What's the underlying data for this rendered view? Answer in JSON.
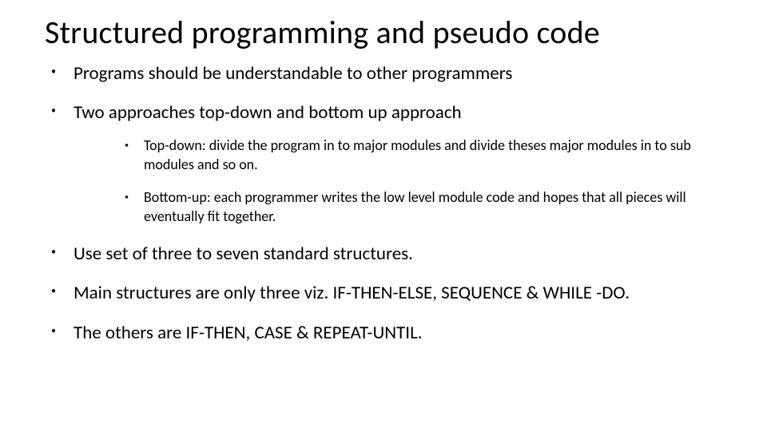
{
  "title": "Structured programming and pseudo code",
  "bullets": [
    {
      "text": "Programs should be understandable to other programmers"
    },
    {
      "text": "Two approaches top-down and bottom up approach",
      "children": [
        "Top-down: divide the program in to major modules and divide theses major modules in to sub modules and so on.",
        "Bottom-up: each programmer writes the low level module code and hopes that all pieces will eventually fit together."
      ]
    },
    {
      "text": "Use set of three to seven standard structures."
    },
    {
      "text": "Main structures are only three viz. IF-THEN-ELSE, SEQUENCE & WHILE -DO."
    },
    {
      "text": "The others are IF-THEN, CASE & REPEAT-UNTIL."
    }
  ]
}
